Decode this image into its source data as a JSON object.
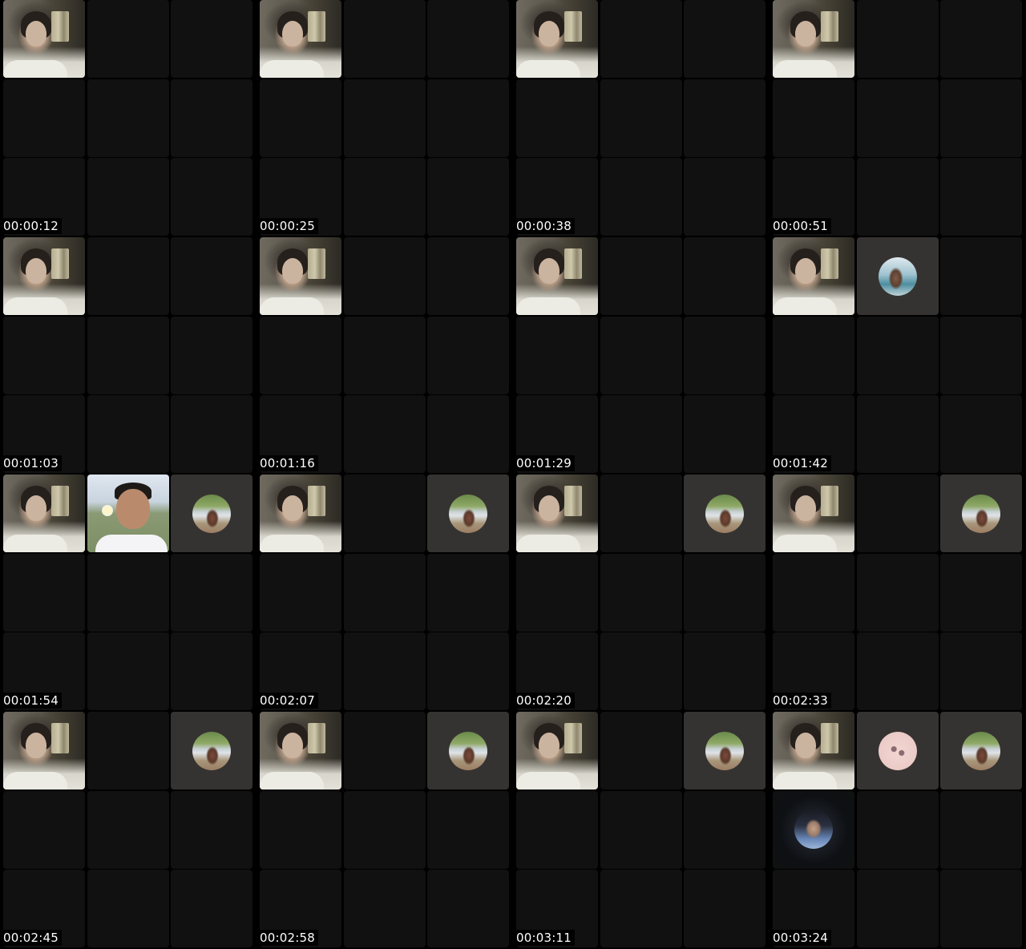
{
  "contact_sheet": {
    "frames": [
      {
        "timestamp": "00:00:12",
        "tiles": [
          "face",
          "empty",
          "empty",
          "empty",
          "empty",
          "empty",
          "empty",
          "empty",
          "empty"
        ]
      },
      {
        "timestamp": "00:00:25",
        "tiles": [
          "face",
          "empty",
          "empty",
          "empty",
          "empty",
          "empty",
          "empty",
          "empty",
          "empty"
        ]
      },
      {
        "timestamp": "00:00:38",
        "tiles": [
          "face",
          "empty",
          "empty",
          "empty",
          "empty",
          "empty",
          "empty",
          "empty",
          "empty"
        ]
      },
      {
        "timestamp": "00:00:51",
        "tiles": [
          "face",
          "empty",
          "empty",
          "empty",
          "empty",
          "empty",
          "empty",
          "empty",
          "empty"
        ]
      },
      {
        "timestamp": "00:01:03",
        "tiles": [
          "face",
          "empty",
          "empty",
          "empty",
          "empty",
          "empty",
          "empty",
          "empty",
          "empty"
        ]
      },
      {
        "timestamp": "00:01:16",
        "tiles": [
          "face",
          "empty",
          "empty",
          "empty",
          "empty",
          "empty",
          "empty",
          "empty",
          "empty"
        ]
      },
      {
        "timestamp": "00:01:29",
        "tiles": [
          "face",
          "empty",
          "empty",
          "empty",
          "empty",
          "empty",
          "empty",
          "empty",
          "empty"
        ]
      },
      {
        "timestamp": "00:01:42",
        "tiles": [
          "face",
          "avatar-pool",
          "empty",
          "empty",
          "empty",
          "empty",
          "empty",
          "empty",
          "empty"
        ]
      },
      {
        "timestamp": "00:01:54",
        "tiles": [
          "face",
          "man",
          "avatar-lake",
          "empty",
          "empty",
          "empty",
          "empty",
          "empty",
          "empty"
        ]
      },
      {
        "timestamp": "00:02:07",
        "tiles": [
          "face",
          "empty",
          "avatar-lake",
          "empty",
          "empty",
          "empty",
          "empty",
          "empty",
          "empty"
        ]
      },
      {
        "timestamp": "00:02:20",
        "tiles": [
          "face",
          "empty",
          "avatar-lake",
          "empty",
          "empty",
          "empty",
          "empty",
          "empty",
          "empty"
        ]
      },
      {
        "timestamp": "00:02:33",
        "tiles": [
          "face",
          "empty",
          "avatar-lake",
          "empty",
          "empty",
          "empty",
          "empty",
          "empty",
          "empty"
        ]
      },
      {
        "timestamp": "00:02:45",
        "tiles": [
          "face",
          "empty",
          "avatar-lake",
          "empty",
          "empty",
          "empty",
          "empty",
          "empty",
          "empty"
        ]
      },
      {
        "timestamp": "00:02:58",
        "tiles": [
          "face",
          "empty",
          "avatar-lake",
          "empty",
          "empty",
          "empty",
          "empty",
          "empty",
          "empty"
        ]
      },
      {
        "timestamp": "00:03:11",
        "tiles": [
          "face",
          "empty",
          "avatar-lake",
          "empty",
          "empty",
          "empty",
          "empty",
          "empty",
          "empty"
        ]
      },
      {
        "timestamp": "00:03:24",
        "tiles": [
          "face",
          "avatar-drawing",
          "avatar-lake",
          "avatar-night",
          "empty",
          "empty",
          "empty",
          "empty",
          "empty"
        ]
      }
    ]
  },
  "colors": {
    "background": "#000000",
    "tile_empty": "#101110",
    "tile_avatar_bg": "#353331",
    "timestamp_text": "#ffffff"
  }
}
